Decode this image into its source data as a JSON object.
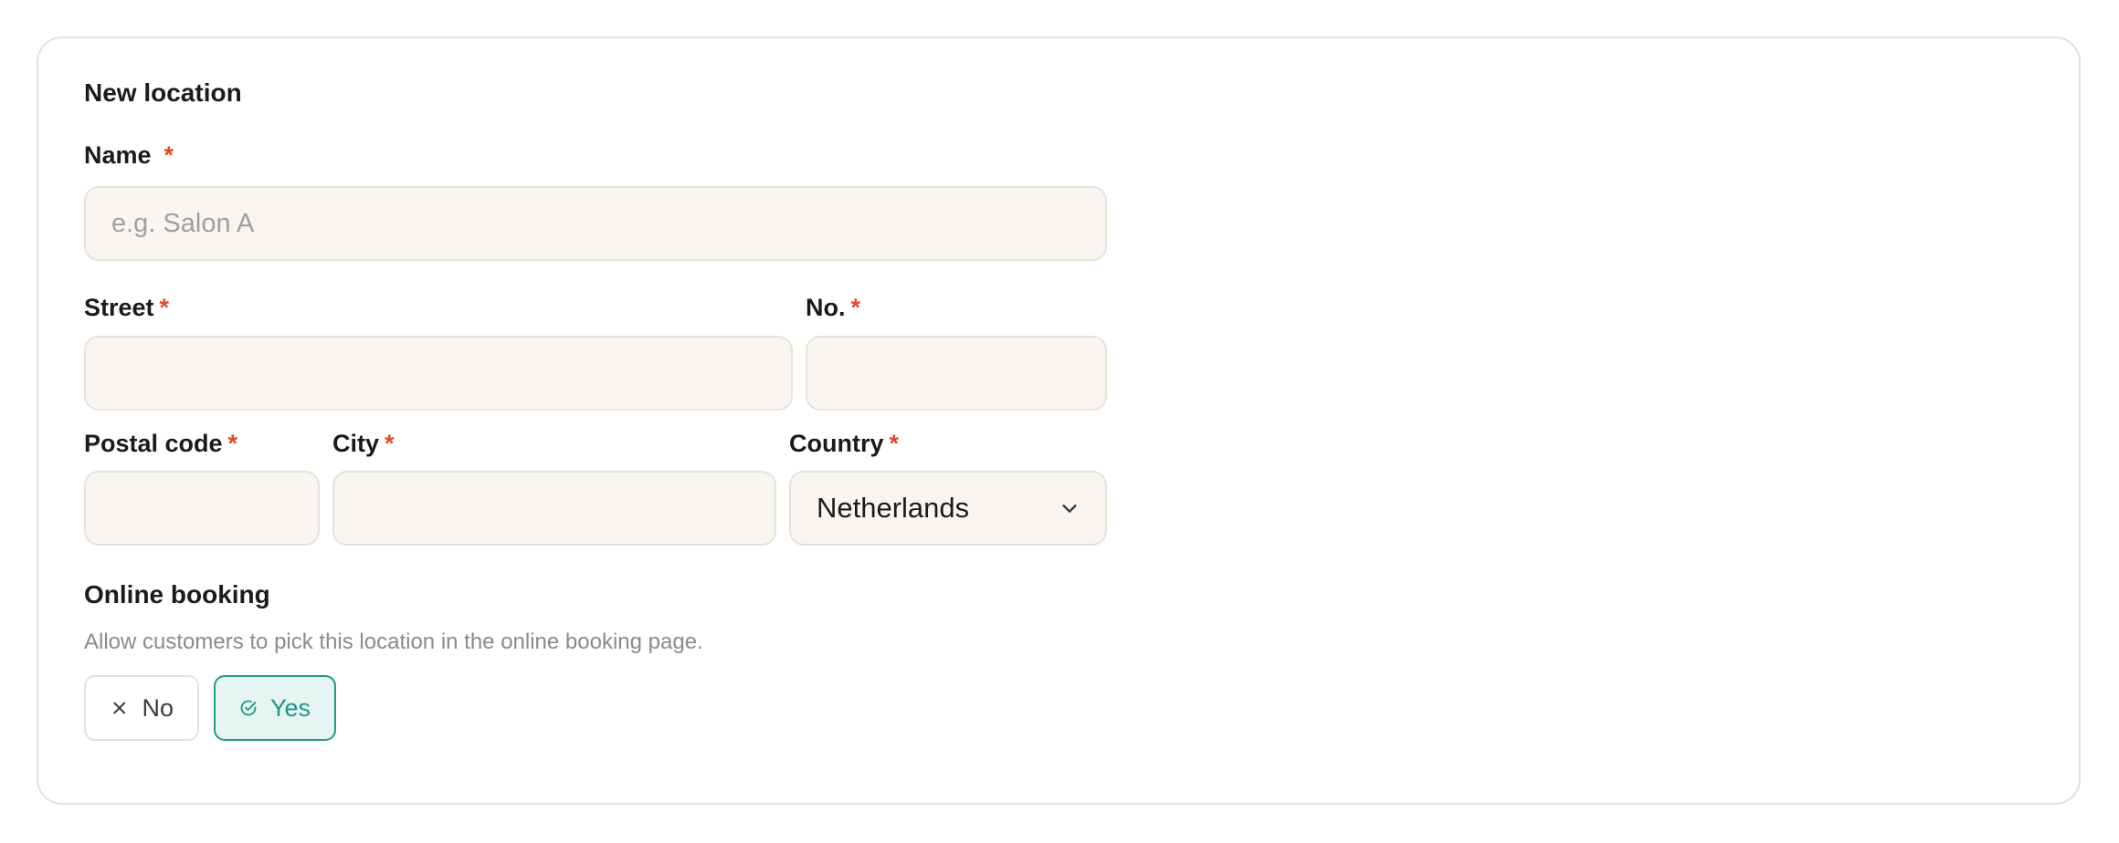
{
  "form": {
    "title": "New location",
    "required_mark": "*",
    "name": {
      "label": "Name",
      "placeholder": "e.g. Salon A",
      "value": ""
    },
    "street": {
      "label": "Street",
      "value": ""
    },
    "number": {
      "label": "No.",
      "value": ""
    },
    "postal_code": {
      "label": "Postal code",
      "value": ""
    },
    "city": {
      "label": "City",
      "value": ""
    },
    "country": {
      "label": "Country",
      "selected": "Netherlands"
    }
  },
  "online_booking": {
    "title": "Online booking",
    "description": "Allow customers to pick this location in the online booking page.",
    "options": [
      {
        "label": "No",
        "icon": "x-icon",
        "selected": false
      },
      {
        "label": "Yes",
        "icon": "check-circle-icon",
        "selected": true
      }
    ]
  },
  "colors": {
    "required": "#e0482b",
    "accent": "#1d9a85",
    "accent_bg": "#e7f5f2",
    "field_bg": "#f9f6f1"
  }
}
